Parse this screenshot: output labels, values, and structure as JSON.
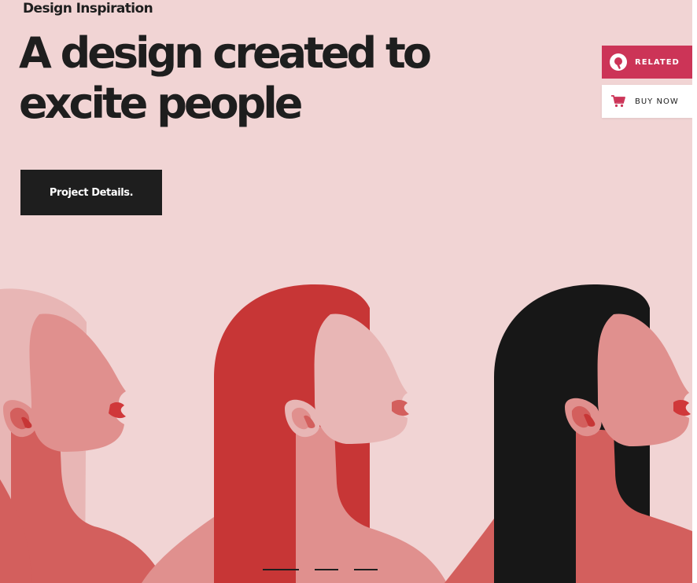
{
  "hero": {
    "eyebrow": "Design Inspiration",
    "headline_line1": "A design created to",
    "headline_line2": "excite people",
    "cta_label": "Project Details."
  },
  "side_buttons": {
    "related_label": "RELATED",
    "buy_label": "BUY NOW"
  },
  "slider": {
    "slide_count": 3,
    "active_index": 0
  },
  "colors": {
    "background": "#f1d4d4",
    "text": "#1e1e1e",
    "accent": "#cc3457",
    "hair_red": "#c73636",
    "hair_black": "#171717",
    "skin_light": "#e8b6b5",
    "skin_mid": "#e0908e",
    "skin_dark": "#d35f5d",
    "lips": "#d0383a"
  },
  "icons": {
    "related": "related-logo-icon",
    "buy": "cart-icon"
  }
}
